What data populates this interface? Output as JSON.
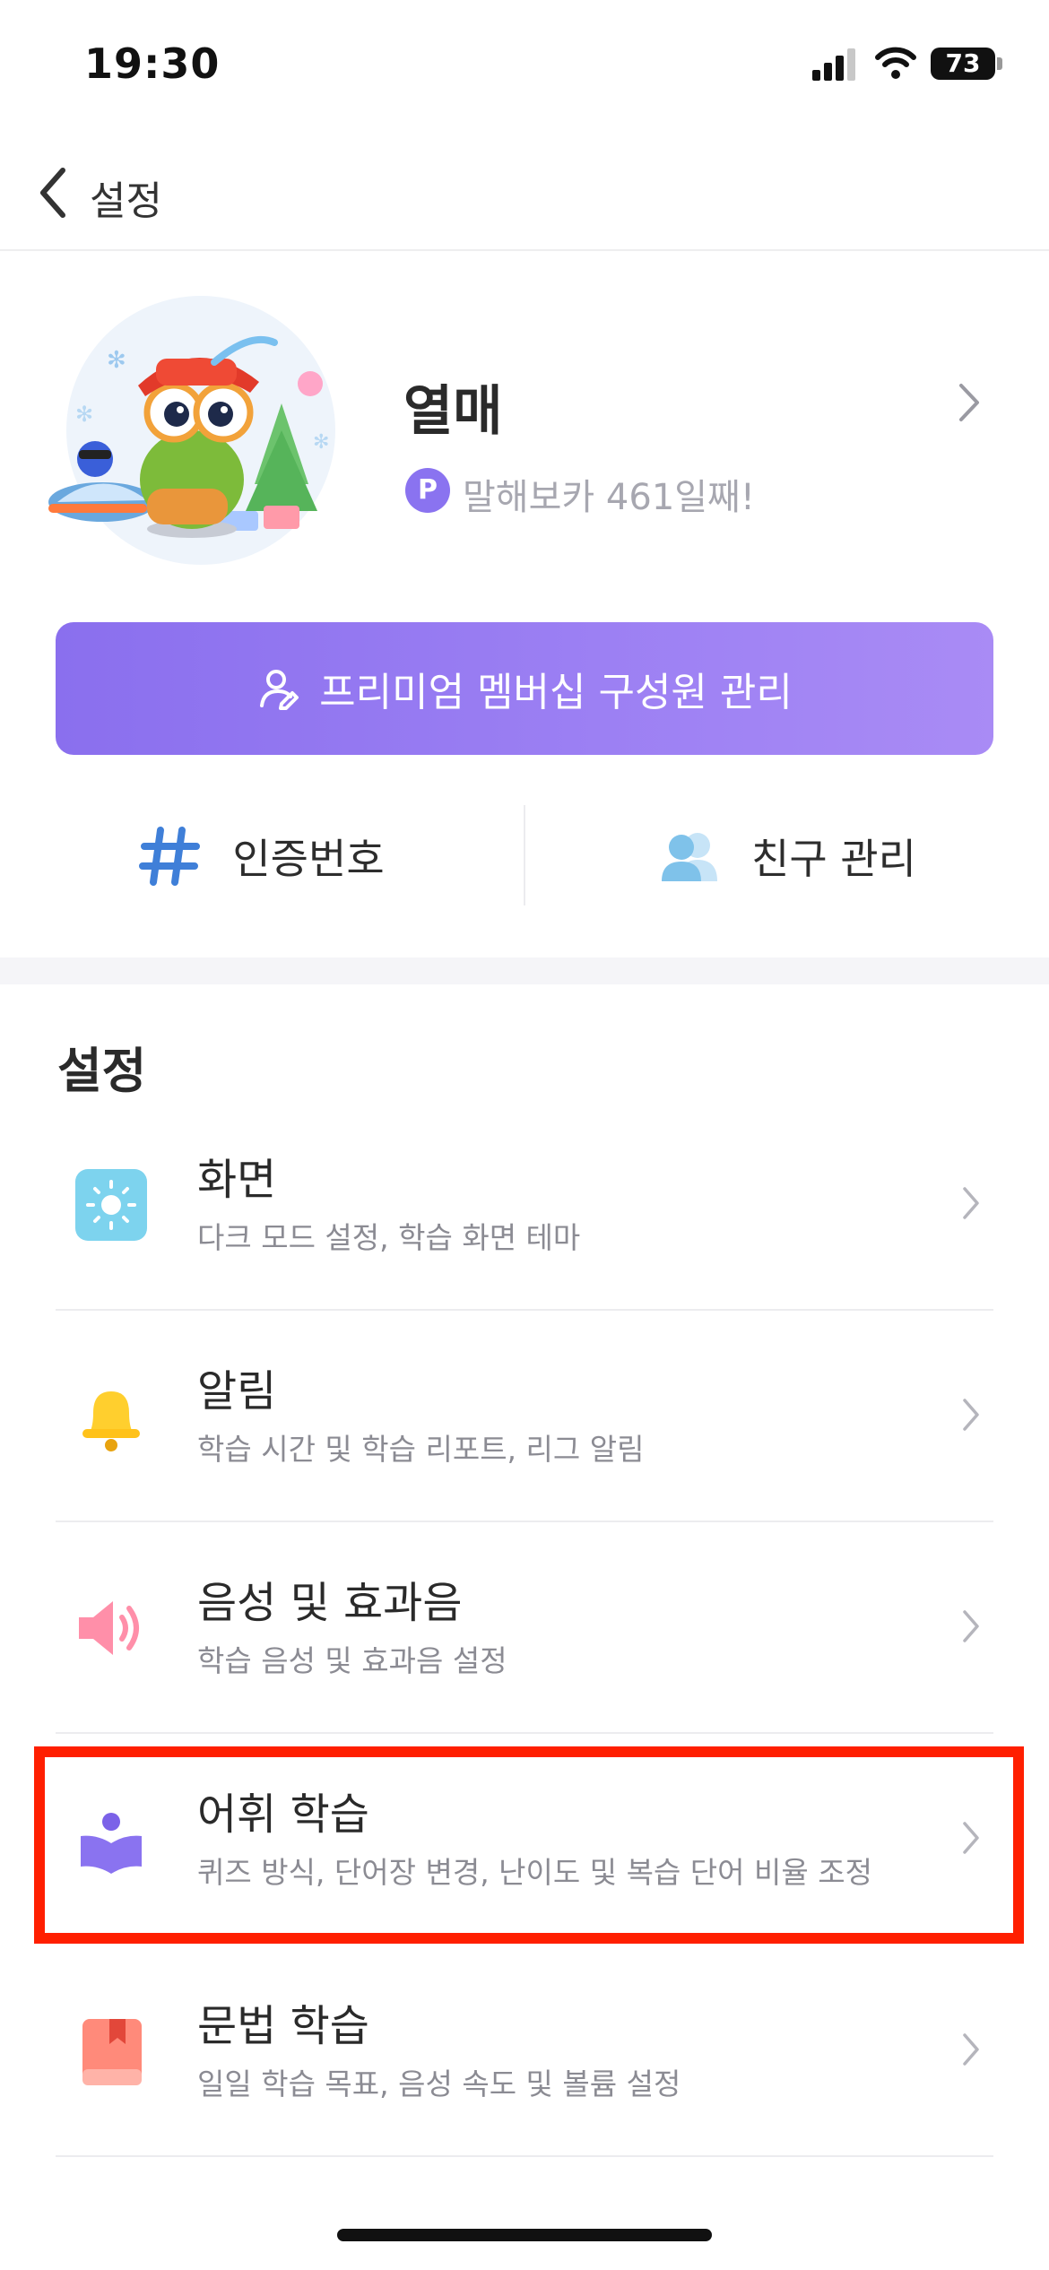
{
  "status_bar": {
    "time": "19:30",
    "battery": "73"
  },
  "nav": {
    "back_label": "설정"
  },
  "profile": {
    "name": "열매",
    "badge": "P",
    "subtitle": "말해보카 461일째!"
  },
  "premium": {
    "label": "프리미엄 멤버십 구성원 관리"
  },
  "quick": {
    "code_label": "인증번호",
    "friends_label": "친구 관리"
  },
  "settings": {
    "title": "설정",
    "items": [
      {
        "title": "화면",
        "subtitle": "다크 모드 설정, 학습 화면 테마"
      },
      {
        "title": "알림",
        "subtitle": "학습 시간 및 학습 리포트, 리그 알림"
      },
      {
        "title": "음성 및 효과음",
        "subtitle": "학습 음성 및 효과음 설정"
      },
      {
        "title": "어휘 학습",
        "subtitle": "퀴즈 방식, 단어장 변경, 난이도 및 복습 단어 비율 조정"
      },
      {
        "title": "문법 학습",
        "subtitle": "일일 학습 목표, 음성 속도 및 볼륨 설정"
      }
    ]
  },
  "colors": {
    "accent": "#8a73f0",
    "highlight": "#ff1f00",
    "screen_icon": "#7dd3ee",
    "bell_icon": "#ffcf2e",
    "speaker_icon": "#ff8fa9",
    "vocab_icon": "#8a73f0",
    "grammar_icon": "#ff8a7a"
  }
}
